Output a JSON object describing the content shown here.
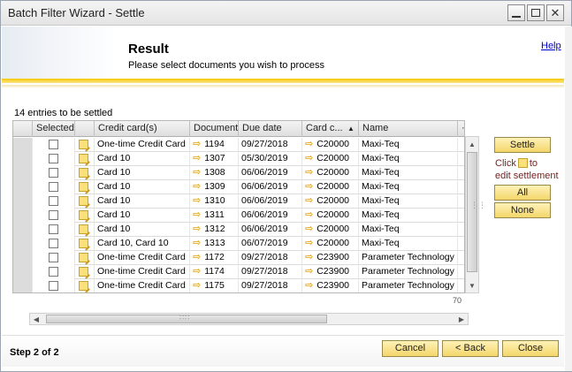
{
  "window": {
    "title": "Batch Filter Wizard - Settle"
  },
  "header": {
    "title": "Result",
    "subtitle": "Please select documents you wish to process",
    "help": "Help"
  },
  "grid": {
    "count_label": "14 entries to be settled",
    "columns": [
      "Selected",
      "Credit card(s)",
      "Document",
      "Due date",
      "Card c...",
      "Name"
    ],
    "rows": [
      {
        "card": "One-time Credit Card",
        "doc": "1194",
        "due": "09/27/2018",
        "code": "C20000",
        "name": "Maxi-Teq"
      },
      {
        "card": "Card 10",
        "doc": "1307",
        "due": "05/30/2019",
        "code": "C20000",
        "name": "Maxi-Teq"
      },
      {
        "card": "Card 10",
        "doc": "1308",
        "due": "06/06/2019",
        "code": "C20000",
        "name": "Maxi-Teq"
      },
      {
        "card": "Card 10",
        "doc": "1309",
        "due": "06/06/2019",
        "code": "C20000",
        "name": "Maxi-Teq"
      },
      {
        "card": "Card 10",
        "doc": "1310",
        "due": "06/06/2019",
        "code": "C20000",
        "name": "Maxi-Teq"
      },
      {
        "card": "Card 10",
        "doc": "1311",
        "due": "06/06/2019",
        "code": "C20000",
        "name": "Maxi-Teq"
      },
      {
        "card": "Card 10",
        "doc": "1312",
        "due": "06/06/2019",
        "code": "C20000",
        "name": "Maxi-Teq"
      },
      {
        "card": "Card 10, Card 10",
        "doc": "1313",
        "due": "06/07/2019",
        "code": "C20000",
        "name": "Maxi-Teq"
      },
      {
        "card": "One-time Credit Card",
        "doc": "1172",
        "due": "09/27/2018",
        "code": "C23900",
        "name": "Parameter Technology"
      },
      {
        "card": "One-time Credit Card",
        "doc": "1174",
        "due": "09/27/2018",
        "code": "C23900",
        "name": "Parameter Technology"
      },
      {
        "card": "One-time Credit Card",
        "doc": "1175",
        "due": "09/27/2018",
        "code": "C23900",
        "name": "Parameter Technology"
      }
    ],
    "scroll_fragment": "70"
  },
  "side": {
    "settle": "Settle",
    "click": "Click",
    "to": "to",
    "edit": "edit settlement",
    "all": "All",
    "none": "None"
  },
  "footer": {
    "step": "Step 2 of 2",
    "cancel": "Cancel",
    "back": "< Back",
    "close": "Close"
  },
  "icons": {
    "minimize": "minimize-icon",
    "maximize": "maximize-icon",
    "close": "close-icon",
    "row_doc": "document-edit-icon",
    "link": "link-arrow-icon",
    "sort": "sort-ascending-icon"
  },
  "colors": {
    "accent_gold": "#f6c700",
    "button_gold": "#f3d66a",
    "link_arrow": "#e2a500",
    "help_link": "#0000cc"
  }
}
